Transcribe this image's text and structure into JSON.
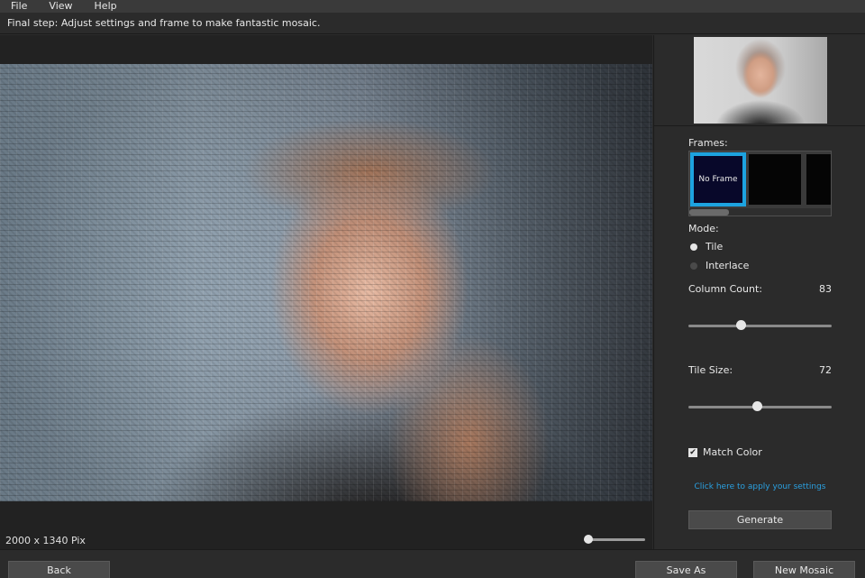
{
  "menu": {
    "items": [
      "File",
      "View",
      "Help"
    ]
  },
  "instruction": "Final step: Adjust settings and frame to make fantastic mosaic.",
  "canvas": {
    "dimensions": "2000 x 1340 Pix",
    "zoom_level": 0
  },
  "right_panel": {
    "frames_label": "Frames:",
    "frames": [
      {
        "label": "No Frame",
        "selected": true
      },
      {
        "label": "",
        "selected": false
      },
      {
        "label": "",
        "selected": false
      }
    ],
    "mode_label": "Mode:",
    "modes": [
      {
        "label": "Tile",
        "selected": true
      },
      {
        "label": "Interlace",
        "selected": false
      }
    ],
    "column_count": {
      "label": "Column Count:",
      "value": "83",
      "fraction": 0.36
    },
    "tile_size": {
      "label": "Tile Size:",
      "value": "72",
      "fraction": 0.48
    },
    "match_color": {
      "label": "Match Color",
      "checked": true,
      "check_glyph": "✔"
    },
    "apply_link": "Click here to apply your settings",
    "generate_label": "Generate"
  },
  "bottom": {
    "back_label": "Back",
    "save_as_label": "Save As",
    "new_mosaic_label": "New Mosaic"
  },
  "colors": {
    "accent": "#1da3e0",
    "link": "#2aa0e0",
    "background": "#2b2b2b"
  }
}
